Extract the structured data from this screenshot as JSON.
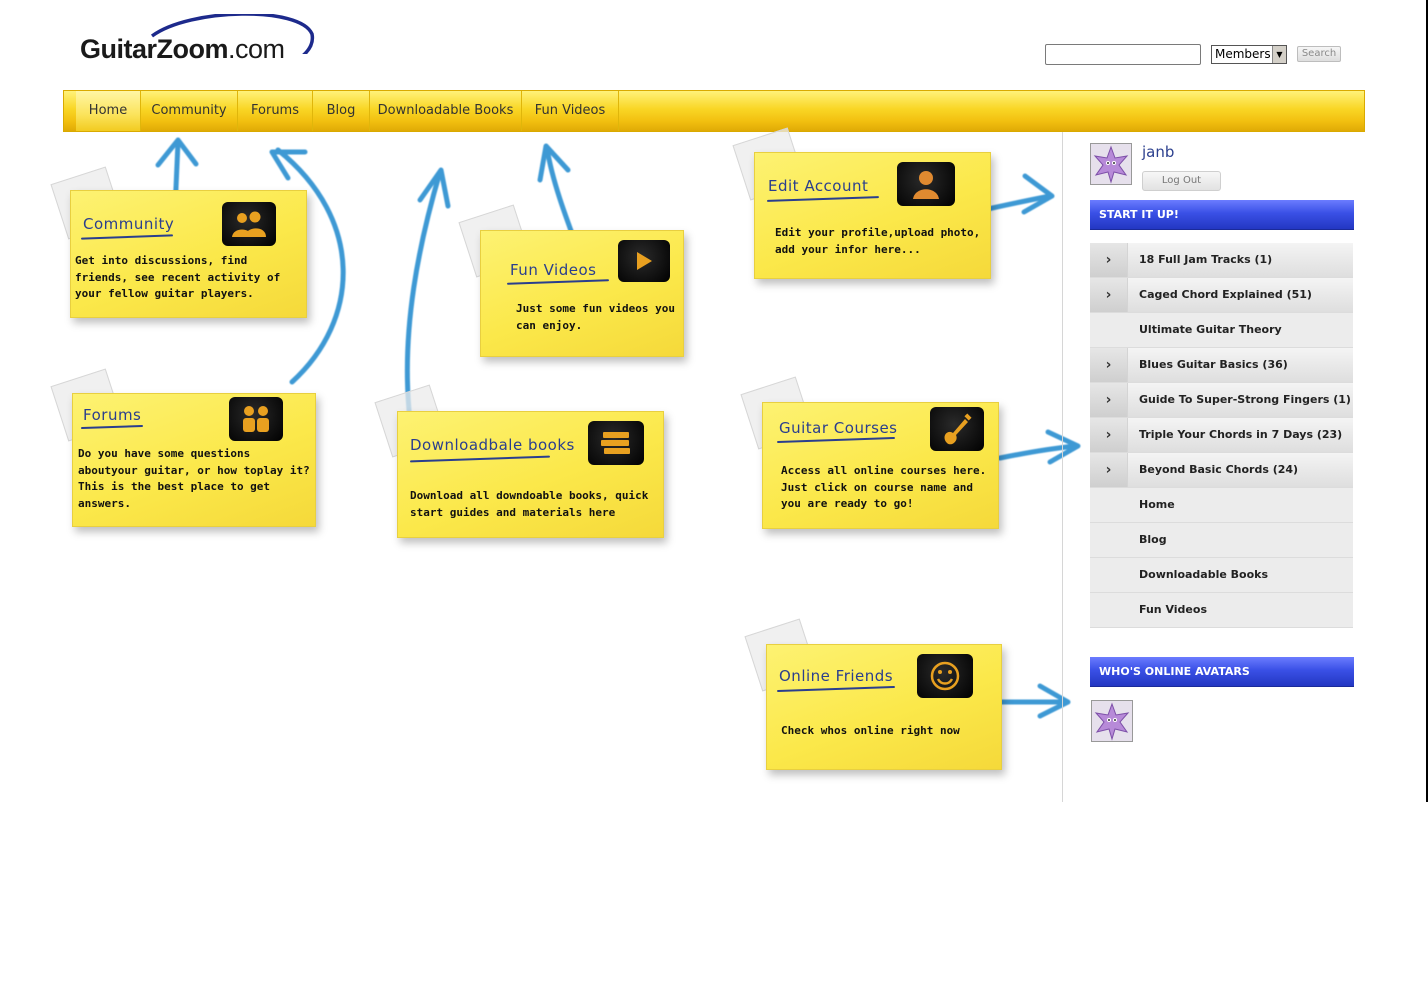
{
  "site": {
    "logo_bold": "GuitarZoom",
    "logo_rest": ".com"
  },
  "search": {
    "value": "",
    "scope": "Members",
    "button_label": "Search"
  },
  "nav": {
    "items": [
      {
        "label": "Home",
        "active": true
      },
      {
        "label": "Community"
      },
      {
        "label": "Forums"
      },
      {
        "label": "Blog"
      },
      {
        "label": "Downloadable Books"
      },
      {
        "label": "Fun Videos"
      }
    ]
  },
  "notes": {
    "community": {
      "title": "Community",
      "text": "Get into discussions, find friends, see recent activity of your fellow guitar players.",
      "icon": "users-icon"
    },
    "forums": {
      "title": "Forums",
      "text": "Do you have some questions aboutyour guitar, or how toplay it? This is the best place to get answers.",
      "icon": "discussion-icon"
    },
    "fun_videos": {
      "title": "Fun Videos",
      "text": "Just some fun videos you can enjoy.",
      "icon": "play-icon"
    },
    "downloadable_books": {
      "title": "Downloadbale books",
      "text": "Download all downdoable books, quick start guides and materials here",
      "icon": "books-icon"
    },
    "edit_account": {
      "title": "Edit Account",
      "text": "Edit your profile,upload photo, add your infor here...",
      "icon": "profile-icon"
    },
    "guitar_courses": {
      "title": "Guitar Courses",
      "text": "Access all online courses here. Just click on course name and you are ready to go!",
      "icon": "guitar-icon"
    },
    "online_friends": {
      "title": "Online Friends",
      "text": "Check whos online right now",
      "icon": "smiley-icon"
    }
  },
  "user": {
    "name": "janb",
    "logout_label": "Log Out"
  },
  "sidebar": {
    "start_header": "START IT UP!",
    "items": [
      {
        "label": "18 Full Jam Tracks (1)",
        "has_sub": true
      },
      {
        "label": "Caged Chord Explained (51)",
        "has_sub": true
      },
      {
        "label": "Ultimate Guitar Theory",
        "has_sub": false
      },
      {
        "label": "Blues Guitar Basics (36)",
        "has_sub": true
      },
      {
        "label": "Guide To Super-Strong Fingers (1)",
        "has_sub": true
      },
      {
        "label": "Triple Your Chords in 7 Days (23)",
        "has_sub": true
      },
      {
        "label": "Beyond Basic Chords (24)",
        "has_sub": true
      },
      {
        "label": "Home",
        "has_sub": false
      },
      {
        "label": "Blog",
        "has_sub": false
      },
      {
        "label": "Downloadable Books",
        "has_sub": false
      },
      {
        "label": "Fun Videos",
        "has_sub": false
      }
    ],
    "online_header": "WHO'S ONLINE AVATARS"
  },
  "colors": {
    "nav_yellow": "#f9d625",
    "note_yellow": "#fbe84a",
    "title_blue": "#2a3e8e",
    "arrow_blue": "#2a8fd0",
    "header_blue": "#3a50e6"
  }
}
